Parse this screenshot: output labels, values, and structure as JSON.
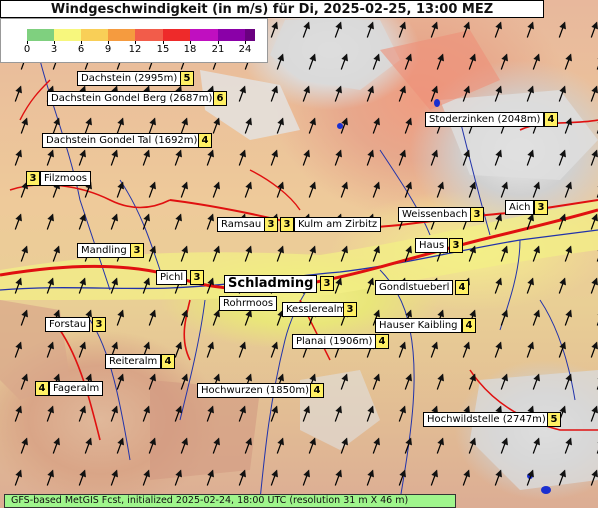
{
  "title": "Windgeschwindigkeit (in m/s) für Di, 2025-02-25, 13:00 MEZ",
  "legend": {
    "ticks": [
      "0",
      "3",
      "6",
      "9",
      "12",
      "15",
      "18",
      "21",
      "24"
    ],
    "colors": [
      "#7fd07f",
      "#f7f77d",
      "#f9cf57",
      "#f59b3f",
      "#f25c4a",
      "#ee2a2a",
      "#c00fc0",
      "#8a00a8"
    ]
  },
  "places": [
    {
      "id": "dachstein",
      "name": "Dachstein (2995m)",
      "value": "5"
    },
    {
      "id": "dachstein-gondel-berg",
      "name": "Dachstein Gondel Berg (2687m)",
      "value": "6"
    },
    {
      "id": "dachstein-gondel-tal",
      "name": "Dachstein Gondel Tal (1692m)",
      "value": "4"
    },
    {
      "id": "filzmoos",
      "name": "Filzmoos",
      "value": "3"
    },
    {
      "id": "mandling",
      "name": "Mandling",
      "value": "3"
    },
    {
      "id": "ramsau",
      "name": "Ramsau",
      "value": "3"
    },
    {
      "id": "kulm",
      "name": "Kulm am Zirbitz",
      "value": "3"
    },
    {
      "id": "pichl",
      "name": "Pichl",
      "value": "3"
    },
    {
      "id": "schladming",
      "name": "Schladming",
      "value": "3"
    },
    {
      "id": "rohrmoos",
      "name": "Rohrmoos",
      "value": ""
    },
    {
      "id": "kesslerealm",
      "name": "Kesslerealm",
      "value": "3"
    },
    {
      "id": "forstau",
      "name": "Forstau",
      "value": "3"
    },
    {
      "id": "planai",
      "name": "Planai (1906m)",
      "value": "4"
    },
    {
      "id": "reiteralm",
      "name": "Reiteralm",
      "value": "4"
    },
    {
      "id": "fageralm",
      "name": "Fageralm",
      "value": "4"
    },
    {
      "id": "hochwurzen",
      "name": "Hochwurzen (1850m)",
      "value": "4"
    },
    {
      "id": "stoderzinken",
      "name": "Stoderzinken (2048m)",
      "value": "4"
    },
    {
      "id": "weissenbach",
      "name": "Weissenbach",
      "value": "3"
    },
    {
      "id": "aich",
      "name": "Aich",
      "value": "3"
    },
    {
      "id": "haus",
      "name": "Haus",
      "value": "3"
    },
    {
      "id": "gondlstueberl",
      "name": "Gondlstueberl",
      "value": "4"
    },
    {
      "id": "hauser-kaibling",
      "name": "Hauser Kaibling",
      "value": "4"
    },
    {
      "id": "hochwildstelle",
      "name": "Hochwildstelle (2747m)",
      "value": "5"
    }
  ],
  "footer": "GFS-based MetGIS Fcst, initialized 2025-02-24, 18:00 UTC  (resolution 31 m X 46 m)"
}
